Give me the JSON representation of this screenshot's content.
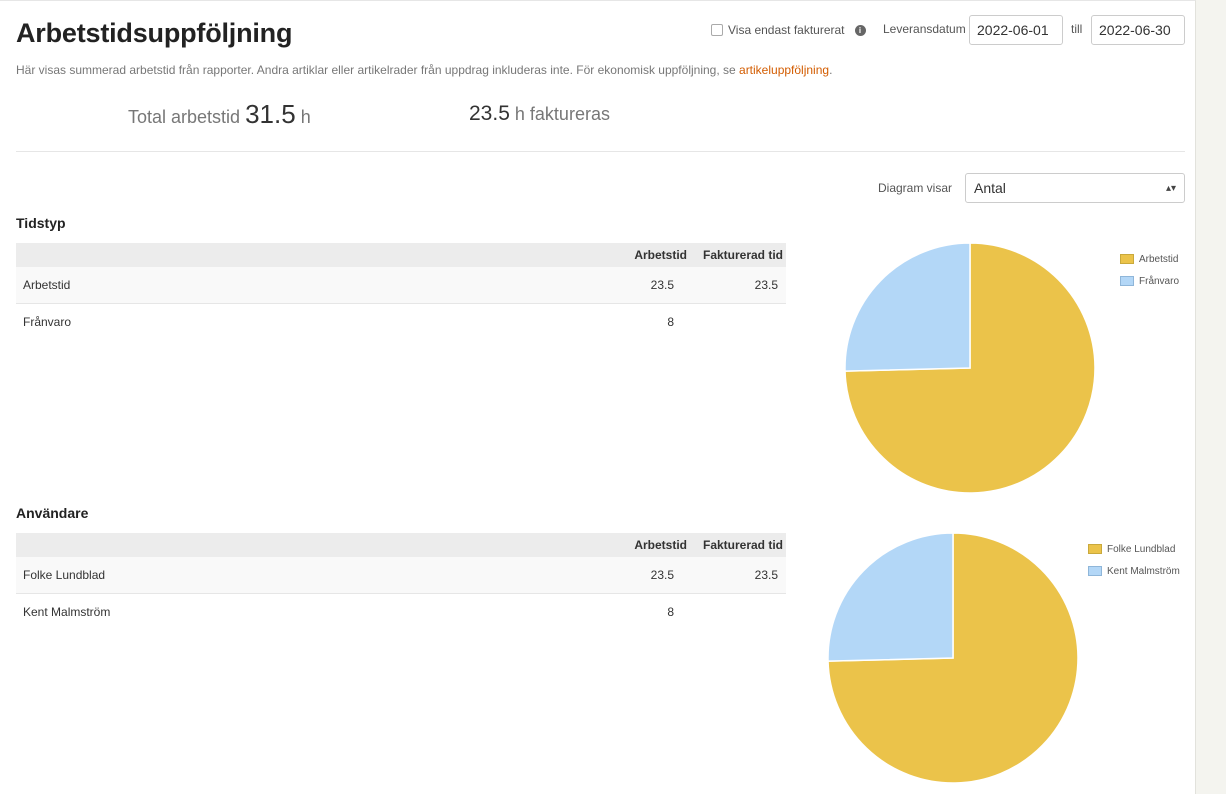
{
  "page": {
    "title": "Arbetstidsuppföljning",
    "subtitle_text": "Här visas summerad arbetstid från rapporter. Andra artiklar eller artikelrader från uppdrag inkluderas inte. För ekonomisk uppföljning, se ",
    "subtitle_link": "artikeluppföljning",
    "subtitle_end": "."
  },
  "filters": {
    "only_invoiced_label": "Visa endast fakturerat",
    "only_invoiced_checked": false,
    "delivery_date_label": "Leveransdatum",
    "date_from": "2022-06-01",
    "to_label": "till",
    "date_to": "2022-06-30"
  },
  "summary": {
    "total_label": "Total arbetstid",
    "total_value": "31.5",
    "total_unit": "h",
    "invoiced_value": "23.5",
    "invoiced_unit": "h",
    "invoiced_label": "faktureras"
  },
  "chart_selector": {
    "label": "Diagram visar",
    "selected": "Antal"
  },
  "colors": {
    "primary": "#ebc34a",
    "secondary": "#b3d7f7",
    "link": "#d35c00"
  },
  "tidstyp": {
    "title": "Tidstyp",
    "headers": [
      "",
      "Arbetstid",
      "Fakturerad tid"
    ],
    "rows": [
      {
        "name": "Arbetstid",
        "worked": "23.5",
        "invoiced": "23.5"
      },
      {
        "name": "Frånvaro",
        "worked": "8",
        "invoiced": ""
      }
    ]
  },
  "anvandare": {
    "title": "Användare",
    "headers": [
      "",
      "Arbetstid",
      "Fakturerad tid"
    ],
    "rows": [
      {
        "name": "Folke Lundblad",
        "worked": "23.5",
        "invoiced": "23.5"
      },
      {
        "name": "Kent Malmström",
        "worked": "8",
        "invoiced": ""
      }
    ]
  },
  "chart_data": [
    {
      "type": "pie",
      "categories": [
        "Arbetstid",
        "Frånvaro"
      ],
      "values": [
        23.5,
        8
      ],
      "colors": [
        "#ebc34a",
        "#b3d7f7"
      ],
      "legend": "top-right"
    },
    {
      "type": "pie",
      "categories": [
        "Folke Lundblad",
        "Kent Malmström"
      ],
      "values": [
        23.5,
        8
      ],
      "colors": [
        "#ebc34a",
        "#b3d7f7"
      ],
      "legend": "top-right"
    }
  ]
}
